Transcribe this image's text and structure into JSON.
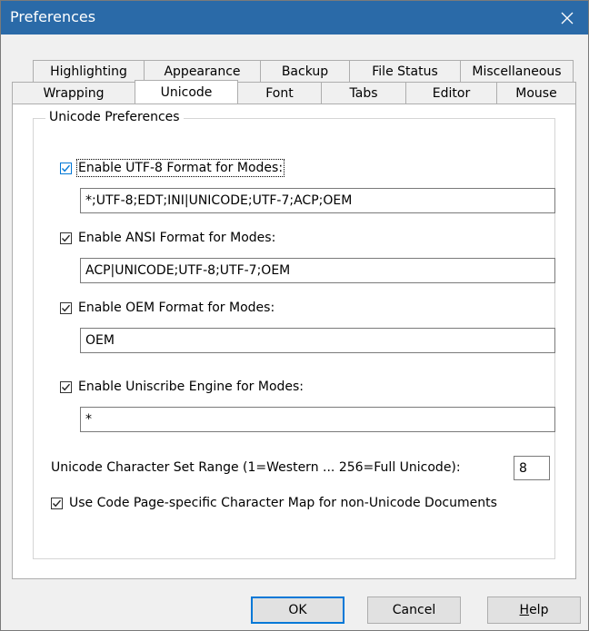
{
  "window": {
    "title": "Preferences"
  },
  "tabs": {
    "row1": [
      "Highlighting",
      "Appearance",
      "Backup",
      "File Status",
      "Miscellaneous"
    ],
    "row2": [
      "Wrapping",
      "Unicode",
      "Font",
      "Tabs",
      "Editor",
      "Mouse"
    ],
    "selected": "Unicode"
  },
  "unicode": {
    "group_title": "Unicode Preferences",
    "utf8": {
      "label": "Enable UTF-8 Format for Modes:",
      "checked": true,
      "value": "*;UTF-8;EDT;INI|UNICODE;UTF-7;ACP;OEM"
    },
    "ansi": {
      "label": "Enable ANSI Format for Modes:",
      "checked": true,
      "value": "ACP|UNICODE;UTF-8;UTF-7;OEM"
    },
    "oem": {
      "label": "Enable OEM Format for Modes:",
      "checked": true,
      "value": "OEM"
    },
    "uniscribe": {
      "label": "Enable Uniscribe Engine for Modes:",
      "checked": true,
      "value": "*"
    },
    "charset_range": {
      "label": "Unicode Character Set Range (1=Western ... 256=Full Unicode):",
      "value": "8"
    },
    "codepage_map": {
      "label": "Use Code Page-specific Character Map for non-Unicode Documents",
      "checked": true
    }
  },
  "buttons": {
    "ok": "OK",
    "cancel": "Cancel",
    "help_mnemonic": "H",
    "help_rest": "elp"
  },
  "colors": {
    "titlebar": "#2a6aa8",
    "accent": "#0078d7"
  },
  "icons": {
    "close": "close-icon",
    "check": "checkmark-icon"
  }
}
